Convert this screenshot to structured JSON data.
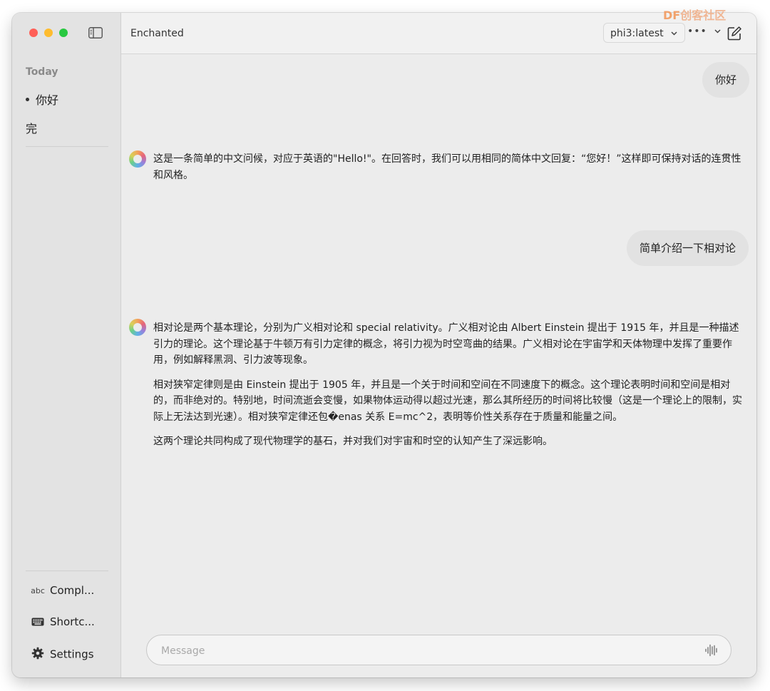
{
  "window": {
    "app_title": "Enchanted"
  },
  "sidebar": {
    "section_header": "Today",
    "conversations": [
      {
        "label": "你好",
        "active": true
      },
      {
        "label": "完",
        "active": false
      }
    ],
    "bottom_items": [
      {
        "icon": "abc-text-icon",
        "icon_text": "abc",
        "label": "Compl..."
      },
      {
        "icon": "keyboard-icon",
        "label": "Shortc..."
      },
      {
        "icon": "gear-icon",
        "label": "Settings"
      }
    ]
  },
  "toolbar": {
    "model_selected": "phi3:latest",
    "more_label": "•••"
  },
  "messages": [
    {
      "role": "user",
      "text": "你好"
    },
    {
      "role": "assistant",
      "paragraphs": [
        "这是一条简单的中文问候，对应于英语的\"Hello!\"。在回答时，我们可以用相同的简体中文回复：“您好！”这样即可保持对话的连贯性和风格。"
      ]
    },
    {
      "role": "user",
      "text": "简单介绍一下相对论"
    },
    {
      "role": "assistant",
      "paragraphs": [
        "相对论是两个基本理论，分别为广义相对论和 special relativity。广义相对论由 Albert Einstein 提出于 1915 年，并且是一种描述引力的理论。这个理论基于牛顿万有引力定律的概念，将引力视为时空弯曲的结果。广义相对论在宇宙学和天体物理中发挥了重要作用，例如解释黑洞、引力波等现象。",
        "相对狭窄定律则是由 Einstein 提出于 1905 年，并且是一个关于时间和空间在不同速度下的概念。这个理论表明时间和空间是相对的，而非绝对的。特别地，时间流逝会变慢，如果物体运动得以超过光速，那么其所经历的时间将比较慢（这是一个理论上的限制，实际上无法达到光速）。相对狭窄定律还包�enas 关系 E=mc^2，表明等价性关系存在于质量和能量之间。",
        "这两个理论共同构成了现代物理学的基石，并对我们对宇宙和时空的认知产生了深远影响。"
      ]
    }
  ],
  "input": {
    "placeholder": "Message",
    "value": ""
  },
  "watermark": {
    "brand": "DF",
    "text": "创客社区"
  },
  "colors": {
    "traffic_red": "#ff5f57",
    "traffic_yellow": "#febc2e",
    "traffic_green": "#28c840",
    "user_bubble": "#e2e2e2",
    "sidebar_bg": "#e3e3e3",
    "main_bg": "#ececec"
  }
}
